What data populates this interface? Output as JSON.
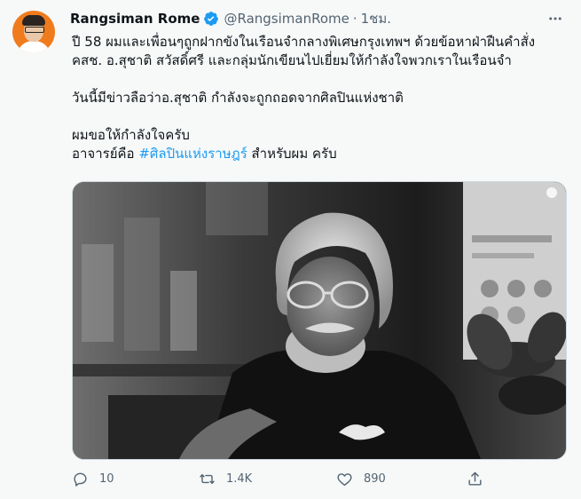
{
  "tweet": {
    "author": {
      "display_name": "Rangsiman Rome",
      "handle": "@RangsimanRome",
      "separator": "·",
      "time": "1ชม."
    },
    "body": {
      "line1": "ปี 58 ผมและเพื่อนๆถูกฝากขังในเรือนจำกลางพิเศษกรุงเทพฯ ด้วยข้อหาฝ่าฝืนคำสั่ง",
      "line2": "คสช. อ.สุชาติ สวัสดิ์ศรี และกลุ่มนักเขียนไปเยี่ยมให้กำลังใจพวกเราในเรือนจำ",
      "line3": "วันนี้มีข่าวลือว่าอ.สุชาติ กำลังจะถูกถอดจากศิลปินแห่งชาติ",
      "line4": "ผมขอให้กำลังใจครับ",
      "line5_prefix": "อาจารย์คือ ",
      "hashtag": "#ศิลปินแห่งราษฎร์",
      "line5_suffix": " สำหรับผม ครับ"
    },
    "media": {
      "type": "black-and-white photo"
    },
    "actions": {
      "reply_count": "10",
      "retweet_count": "1.4K",
      "like_count": "890"
    },
    "colors": {
      "accent": "#1d9bf0",
      "text": "#0f1419",
      "secondary": "#536471",
      "background": "#f7f9f9"
    },
    "icons": [
      "verified-badge-icon",
      "more-options-icon",
      "reply-icon",
      "retweet-icon",
      "like-icon",
      "share-icon"
    ]
  }
}
